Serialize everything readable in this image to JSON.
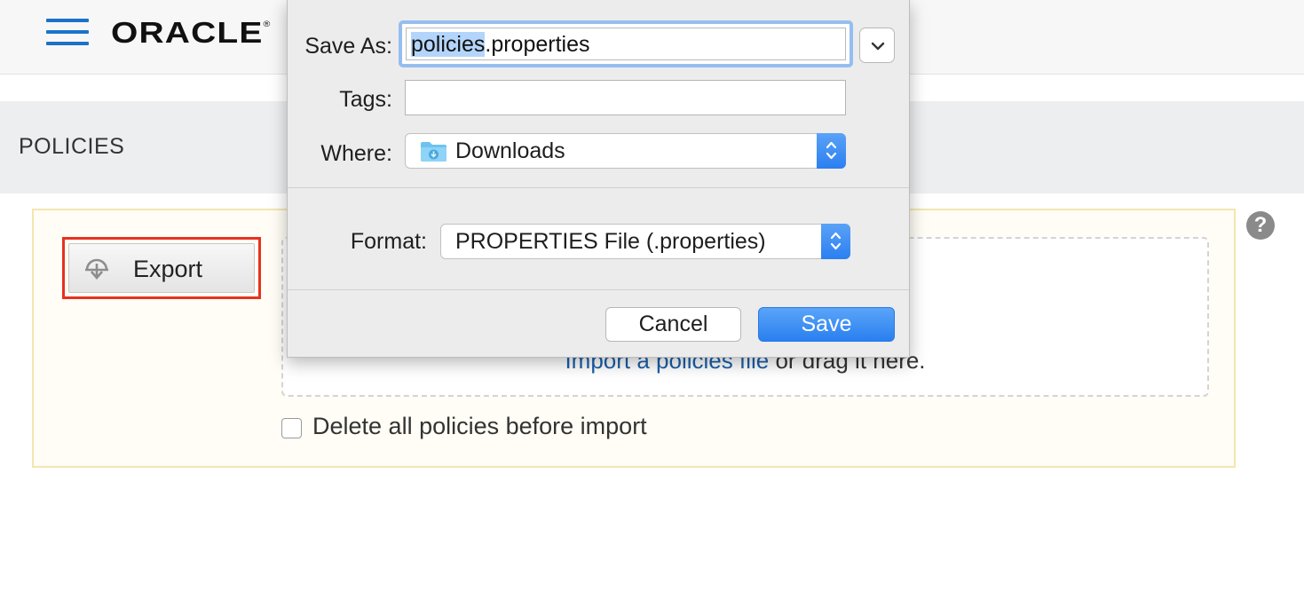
{
  "header": {
    "brand": "ORACLE",
    "brand_mark": "®",
    "menu_icon": "hamburger-icon",
    "accent_color": "#1a73c9"
  },
  "page": {
    "title": "POLICIES"
  },
  "panel": {
    "export_label": "Export",
    "export_icon": "cloud-download-icon",
    "dropzone": {
      "link_text": "Import a policies file",
      "rest_text": " or drag it here."
    },
    "delete_checkbox": {
      "label": "Delete all policies before import",
      "checked": false
    },
    "help_icon": "?"
  },
  "save_dialog": {
    "save_as_label": "Save As:",
    "save_as_value_selected": "policies",
    "save_as_value_rest": ".properties",
    "tags_label": "Tags:",
    "tags_value": "",
    "where_label": "Where:",
    "where_value": "Downloads",
    "format_label": "Format:",
    "format_value": "PROPERTIES File (.properties)",
    "cancel_label": "Cancel",
    "save_label": "Save",
    "primary_color": "#2f83f2",
    "selection_color": "#b4d5fb"
  }
}
